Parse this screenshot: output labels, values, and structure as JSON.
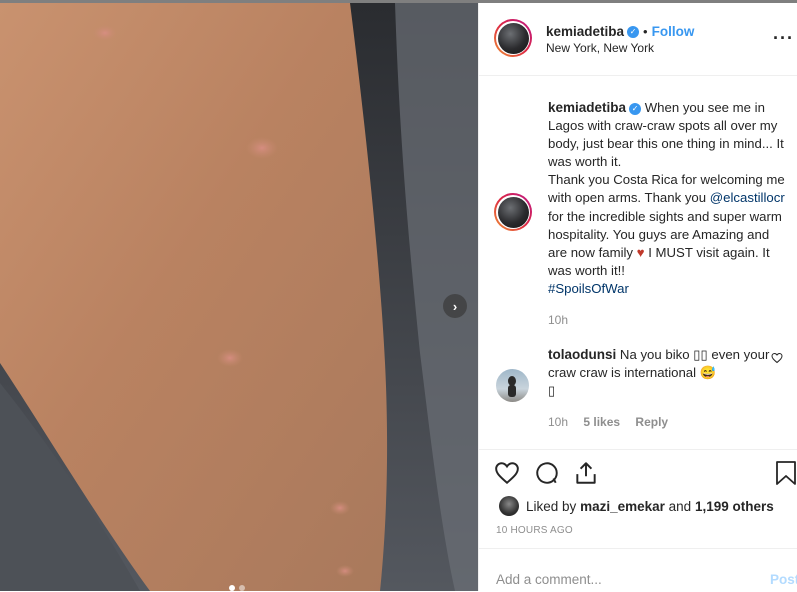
{
  "post": {
    "username": "kemiadetiba",
    "verified_mark": "✓",
    "separator": "•",
    "follow_label": "Follow",
    "location": "New York, New York",
    "more_icon": "more-options-icon"
  },
  "caption": {
    "username": "kemiadetiba",
    "text_part1": "When you see me in Lagos with craw-craw spots all over my body, just bear this one thing in mind... It was worth it.",
    "text_part2": "Thank you Costa Rica for welcoming me with open arms. Thank you",
    "mention": "@elcastillocr",
    "text_part3": "for the incredible sights and super warm hospitality. You guys are Amazing and are now family",
    "heart_emoji": "♥",
    "text_part4": "I MUST visit again. It was worth it!!",
    "hashtag": "#SpoilsOfWar",
    "time": "10h"
  },
  "comment": {
    "username": "tolaodunsi",
    "text_part1": "Na you biko",
    "emoji_boxes": "▯▯",
    "text_part2": "even your craw craw is international",
    "emoji_laugh": "😅",
    "emoji_box_end": "▯",
    "time": "10h",
    "likes": "5 likes",
    "reply_label": "Reply"
  },
  "likes": {
    "prefix": "Liked by",
    "user": "mazi_emekar",
    "conjunction": "and",
    "others": "1,199 others"
  },
  "timestamp": "10 HOURS AGO",
  "add_comment": {
    "placeholder": "Add a comment...",
    "post_label": "Post"
  },
  "carousel": {
    "next_glyph": "›",
    "current_index": 1,
    "total": 2
  },
  "colors": {
    "link_blue": "#3897f0",
    "mention_color": "#003569",
    "heart_red": "#c0392b",
    "muted": "#8e8e8e",
    "post_disabled": "#b3dbff"
  }
}
